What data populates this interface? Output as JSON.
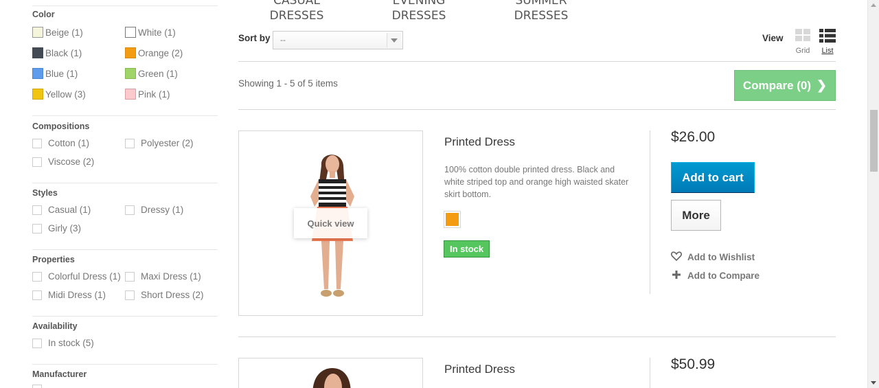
{
  "sidebar": {
    "color": {
      "title": "Color",
      "items": [
        {
          "label": "Beige (1)",
          "color": "#f5f5dc"
        },
        {
          "label": "White (1)",
          "color": "#ffffff"
        },
        {
          "label": "Black (1)",
          "color": "#434a54"
        },
        {
          "label": "Orange (2)",
          "color": "#f39c11"
        },
        {
          "label": "Blue (1)",
          "color": "#5d9cec"
        },
        {
          "label": "Green (1)",
          "color": "#a0d468"
        },
        {
          "label": "Yellow (3)",
          "color": "#f1c40f"
        },
        {
          "label": "Pink (1)",
          "color": "#fccacd"
        }
      ]
    },
    "compositions": {
      "title": "Compositions",
      "items": [
        "Cotton (1)",
        "Polyester (2)",
        "Viscose (2)"
      ]
    },
    "styles": {
      "title": "Styles",
      "items": [
        "Casual (1)",
        "Dressy (1)",
        "Girly (3)"
      ]
    },
    "properties": {
      "title": "Properties",
      "items": [
        "Colorful Dress (1)",
        "Maxi Dress (1)",
        "Midi Dress (1)",
        "Short Dress (2)"
      ]
    },
    "availability": {
      "title": "Availability",
      "items": [
        "In stock (5)"
      ]
    },
    "manufacturer": {
      "title": "Manufacturer"
    }
  },
  "categories": {
    "casual": {
      "line1": "CASUAL",
      "line2": "DRESSES"
    },
    "evening": {
      "line1": "EVENING",
      "line2": "DRESSES"
    },
    "summer": {
      "line1": "SUMMER",
      "line2": "DRESSES"
    }
  },
  "toolbar": {
    "sort_label": "Sort by",
    "sort_value": "--",
    "view_label": "View",
    "grid_label": "Grid",
    "list_label": "List"
  },
  "listing": {
    "showing": "Showing 1 - 5 of 5 items",
    "compare_button": "Compare (0)"
  },
  "products": [
    {
      "name": "Printed Dress",
      "description": "100% cotton double printed dress. Black and white striped top and orange high waisted skater skirt bottom.",
      "price": "$26.00",
      "color_swatch": "#f39c11",
      "stock": "In stock",
      "quick_view": "Quick view",
      "add_to_cart": "Add to cart",
      "more": "More",
      "wishlist": "Add to Wishlist",
      "compare": "Add to Compare"
    },
    {
      "name": "Printed Dress",
      "price": "$50.99"
    }
  ],
  "colors": {
    "accent_blue": "#0079b6",
    "compare_green": "#7ccf87",
    "stock_green": "#55c65e"
  }
}
